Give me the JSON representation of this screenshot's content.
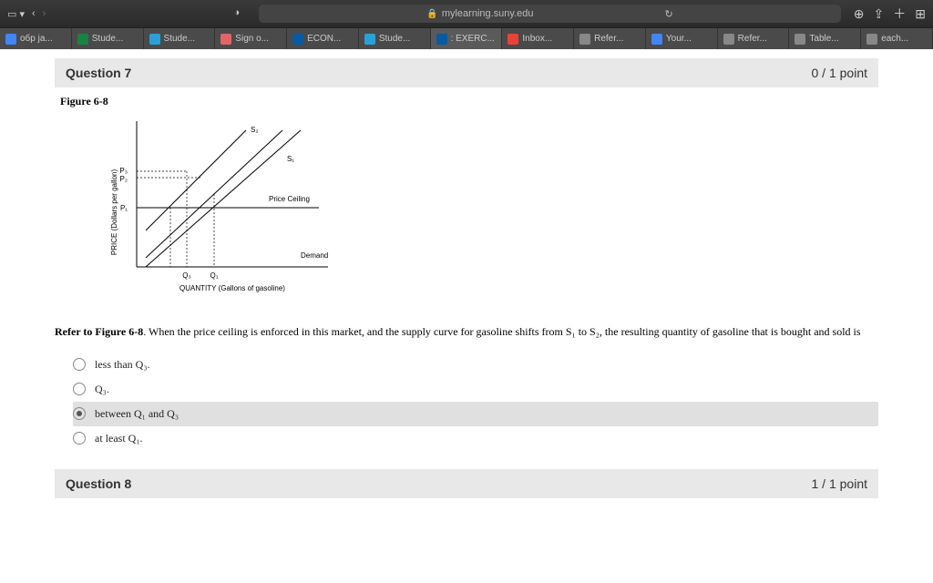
{
  "browser": {
    "url": "mylearning.suny.edu",
    "tabs": [
      {
        "label": "обр ја...",
        "color": "#4285f4"
      },
      {
        "label": "Stude...",
        "color": "#1a8245"
      },
      {
        "label": "Stude...",
        "color": "#2aa0d8"
      },
      {
        "label": "Sign o...",
        "color": "#e06666"
      },
      {
        "label": "ECON...",
        "color": "#0a5aa0"
      },
      {
        "label": "Stude...",
        "color": "#2aa0d8"
      },
      {
        "label": ": EXERC...",
        "color": "#0a5aa0"
      },
      {
        "label": "Inbox...",
        "color": "#ea4335"
      },
      {
        "label": "Refer...",
        "color": "#888"
      },
      {
        "label": "Your...",
        "color": "#4285f4"
      },
      {
        "label": "Refer...",
        "color": "#888"
      },
      {
        "label": "Table...",
        "color": "#888"
      },
      {
        "label": "each...",
        "color": "#888"
      }
    ]
  },
  "question7": {
    "title": "Question 7",
    "points": "0 / 1 point",
    "figure": "Figure 6-8",
    "chart": {
      "ylabel": "PRICE (Dollars per gallon)",
      "xlabel": "QUANTITY (Gallons of gasoline)",
      "s1": "S₁",
      "s2": "S₂",
      "demand": "Demand",
      "ceiling": "Price Ceiling",
      "p1": "P₁",
      "p2": "P₂",
      "p3": "P₃",
      "q1": "Q₁",
      "q3": "Q₃"
    },
    "text": "Refer to Figure 6-8. When the price ceiling is enforced in this market, and the supply curve for gasoline shifts from S₁ to S₂, the resulting quantity of gasoline that is bought and sold is",
    "options": [
      {
        "label": "less than Q₃.",
        "selected": false
      },
      {
        "label": "Q₃.",
        "selected": false
      },
      {
        "label": "between Q₁ and Q₃",
        "selected": true
      },
      {
        "label": "at least Q₁.",
        "selected": false
      }
    ]
  },
  "question8": {
    "title": "Question 8",
    "points": "1 / 1 point"
  },
  "chart_data": {
    "type": "line",
    "title": "Figure 6-8 Supply & Demand with Price Ceiling",
    "xlabel": "QUANTITY (Gallons of gasoline)",
    "ylabel": "PRICE (Dollars per gallon)",
    "series": [
      {
        "name": "Demand",
        "x": [
          0,
          100
        ],
        "y": [
          100,
          0
        ]
      },
      {
        "name": "S₁",
        "x": [
          0,
          100
        ],
        "y": [
          0,
          100
        ]
      },
      {
        "name": "S₂",
        "x": [
          0,
          70
        ],
        "y": [
          30,
          100
        ]
      }
    ],
    "reference_lines": [
      {
        "name": "Price Ceiling",
        "axis": "y",
        "value": 40
      }
    ],
    "annotations": [
      {
        "name": "P₁",
        "axis": "y",
        "value": 40
      },
      {
        "name": "P₂",
        "axis": "y",
        "value": 55
      },
      {
        "name": "P₃",
        "axis": "y",
        "value": 60
      },
      {
        "name": "Q₃",
        "axis": "x",
        "value": 25
      },
      {
        "name": "Q₁",
        "axis": "x",
        "value": 45
      }
    ],
    "xlim": [
      0,
      100
    ],
    "ylim": [
      0,
      100
    ]
  }
}
